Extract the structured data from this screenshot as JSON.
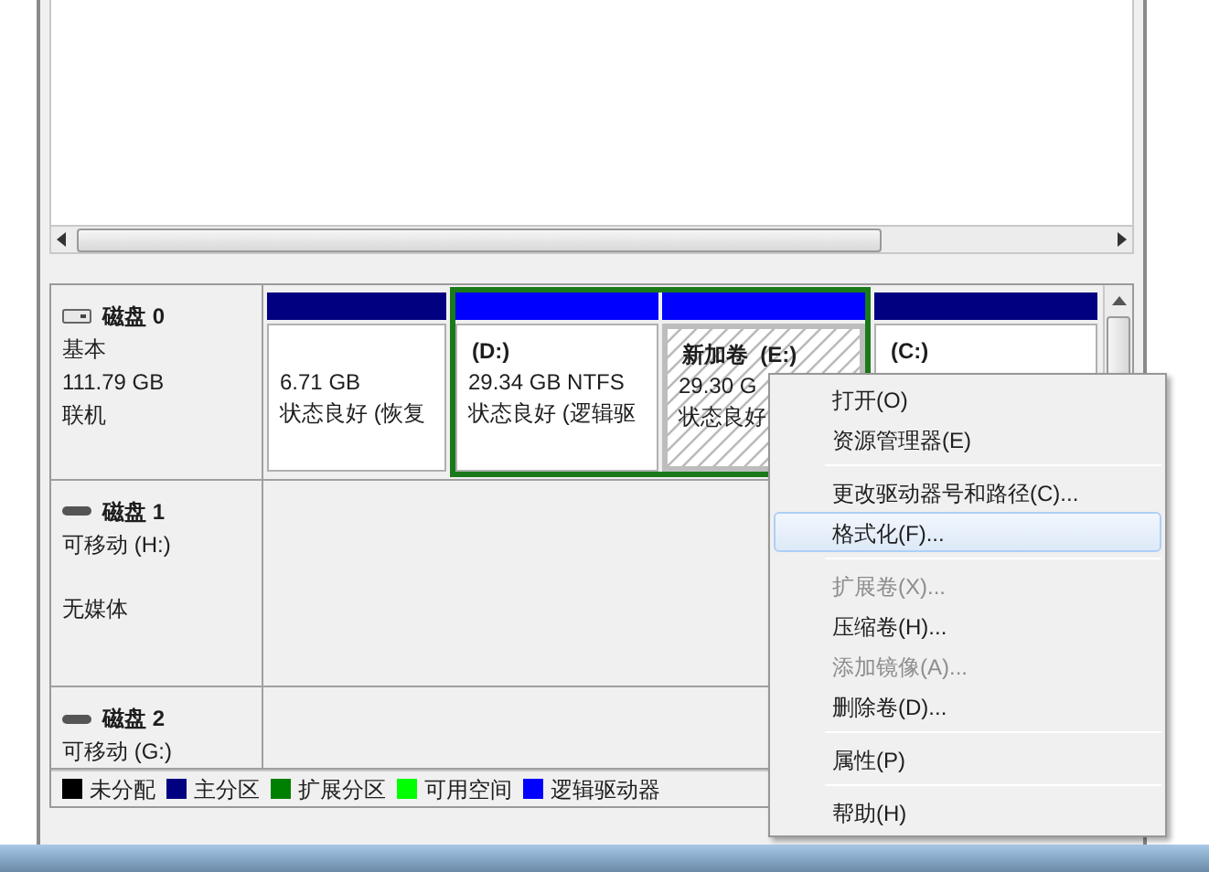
{
  "disks": [
    {
      "name": "磁盘 0",
      "kind": "fixed",
      "lines": [
        "基本",
        "111.79 GB",
        "联机"
      ],
      "partitions": [
        {
          "kind": "primary",
          "color": "#000080",
          "selected": false,
          "lines": [
            "6.71 GB",
            "状态良好 (恢复"
          ]
        },
        {
          "kind": "extended",
          "children": [
            {
              "color": "#0000ff",
              "selected": false,
              "label": "(D:)",
              "lines": [
                "29.34 GB NTFS",
                "状态良好 (逻辑驱"
              ]
            },
            {
              "color": "#0000ff",
              "selected": true,
              "label": "新加卷  (E:)",
              "lines": [
                "29.30 G",
                "状态良好"
              ]
            }
          ]
        },
        {
          "kind": "primary",
          "color": "#000080",
          "selected": false,
          "label": "(C:)"
        }
      ]
    },
    {
      "name": "磁盘 1",
      "kind": "removable",
      "lines": [
        "可移动 (H:)"
      ],
      "status": "无媒体"
    },
    {
      "name": "磁盘 2",
      "kind": "removable",
      "lines": [
        "可移动 (G:)"
      ]
    }
  ],
  "legend": [
    {
      "label": "未分配",
      "color": "#000000"
    },
    {
      "label": "主分区",
      "color": "#000080"
    },
    {
      "label": "扩展分区",
      "color": "#008000"
    },
    {
      "label": "可用空间",
      "color": "#00ff00"
    },
    {
      "label": "逻辑驱动器",
      "color": "#0000ff"
    }
  ],
  "menu": [
    {
      "kind": "item",
      "label": "打开(O)",
      "selected": false,
      "disabled": false
    },
    {
      "kind": "item",
      "label": "资源管理器(E)",
      "selected": false,
      "disabled": false
    },
    {
      "kind": "separator"
    },
    {
      "kind": "item",
      "label": "更改驱动器号和路径(C)...",
      "selected": false,
      "disabled": false
    },
    {
      "kind": "item",
      "label": "格式化(F)...",
      "selected": true,
      "disabled": false
    },
    {
      "kind": "separator"
    },
    {
      "kind": "item",
      "label": "扩展卷(X)...",
      "selected": false,
      "disabled": true
    },
    {
      "kind": "item",
      "label": "压缩卷(H)...",
      "selected": false,
      "disabled": false
    },
    {
      "kind": "item",
      "label": "添加镜像(A)...",
      "selected": false,
      "disabled": true
    },
    {
      "kind": "item",
      "label": "删除卷(D)...",
      "selected": false,
      "disabled": false
    },
    {
      "kind": "separator"
    },
    {
      "kind": "item",
      "label": "属性(P)",
      "selected": false,
      "disabled": false
    },
    {
      "kind": "separator"
    },
    {
      "kind": "item",
      "label": "帮助(H)",
      "selected": false,
      "disabled": false
    }
  ]
}
